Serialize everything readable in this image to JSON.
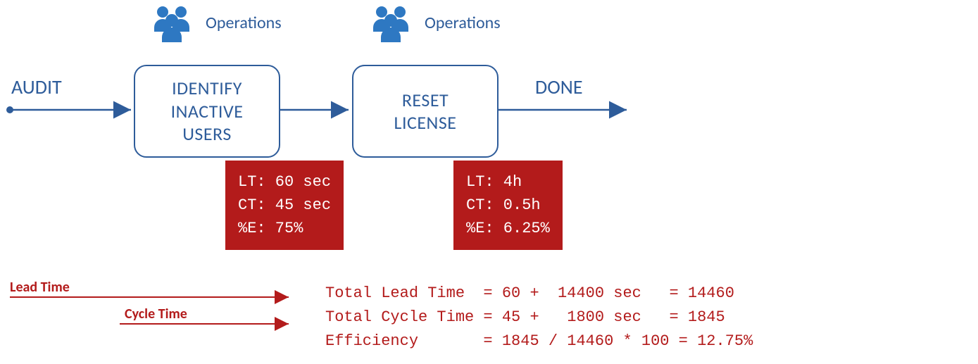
{
  "labels": {
    "audit": "AUDIT",
    "done": "DONE",
    "ops1": "Operations",
    "ops2": "Operations"
  },
  "boxes": {
    "identify": {
      "line1": "IDENTIFY",
      "line2": "INACTIVE",
      "line3": "USERS"
    },
    "reset": {
      "line1": "RESET",
      "line2": "LICENSE"
    }
  },
  "metrics": {
    "m1_line1": "LT: 60 sec",
    "m1_line2": "CT: 45 sec",
    "m1_line3": "%E: 75%",
    "m2_line1": "LT: 4h",
    "m2_line2": "CT: 0.5h",
    "m2_line3": "%E: 6.25%"
  },
  "legend": {
    "lead": "Lead Time",
    "cycle": "Cycle Time"
  },
  "totals": {
    "t1": "Total Lead Time  = 60 +  14400 sec   = 14460",
    "t2": "Total Cycle Time = 45 +   1800 sec   = 1845",
    "t3": "Efficiency       = 1845 / 14460 * 100 = 12.75%"
  },
  "colors": {
    "blue": "#2E5C9A",
    "red": "#B31B1B"
  }
}
